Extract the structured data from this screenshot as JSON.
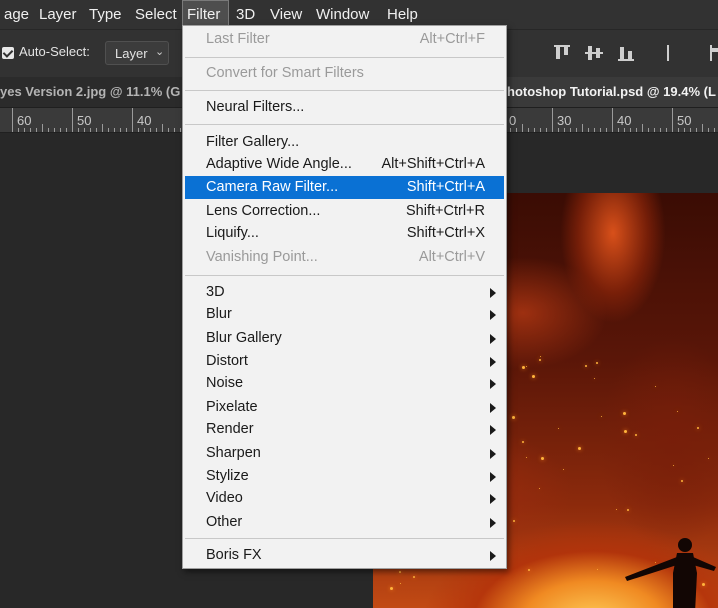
{
  "menubar": {
    "items": [
      {
        "id": "image",
        "label": "age"
      },
      {
        "id": "layer",
        "label": "Layer"
      },
      {
        "id": "type",
        "label": "Type"
      },
      {
        "id": "select",
        "label": "Select"
      },
      {
        "id": "filter",
        "label": "Filter"
      },
      {
        "id": "3d",
        "label": "3D"
      },
      {
        "id": "view",
        "label": "View"
      },
      {
        "id": "window",
        "label": "Window"
      },
      {
        "id": "help",
        "label": "Help"
      }
    ],
    "active": "filter"
  },
  "options_bar": {
    "auto_select_label": "Auto-Select:",
    "auto_select_checked": true,
    "layer_select_value": "Layer",
    "icons": [
      "align-top-icon",
      "align-vertical-center-icon",
      "align-bottom-icon",
      "align-left-icon",
      "align-horizontal-center-icon"
    ]
  },
  "tabs": [
    {
      "label": "yes Version 2.jpg @ 11.1% (G",
      "active": false
    },
    {
      "label": "hotoshop Tutorial.psd @ 19.4% (L",
      "active": true
    }
  ],
  "ruler": {
    "left_numbers": [
      "60",
      "50",
      "40"
    ],
    "right_numbers": [
      "0",
      "30",
      "40",
      "50"
    ]
  },
  "filter_menu": {
    "items": [
      {
        "label": "Last Filter",
        "shortcut": "Alt+Ctrl+F",
        "disabled": true
      },
      {
        "sep": true
      },
      {
        "label": "Convert for Smart Filters",
        "disabled": true
      },
      {
        "sep": true
      },
      {
        "label": "Neural Filters..."
      },
      {
        "sep": true
      },
      {
        "label": "Filter Gallery..."
      },
      {
        "label": "Adaptive Wide Angle...",
        "shortcut": "Alt+Shift+Ctrl+A"
      },
      {
        "label": "Camera Raw Filter...",
        "shortcut": "Shift+Ctrl+A",
        "highlighted": true
      },
      {
        "label": "Lens Correction...",
        "shortcut": "Shift+Ctrl+R"
      },
      {
        "label": "Liquify...",
        "shortcut": "Shift+Ctrl+X"
      },
      {
        "label": "Vanishing Point...",
        "shortcut": "Alt+Ctrl+V",
        "disabled": true
      },
      {
        "sep": true
      },
      {
        "label": "3D",
        "submenu": true
      },
      {
        "label": "Blur",
        "submenu": true
      },
      {
        "label": "Blur Gallery",
        "submenu": true
      },
      {
        "label": "Distort",
        "submenu": true
      },
      {
        "label": "Noise",
        "submenu": true
      },
      {
        "label": "Pixelate",
        "submenu": true
      },
      {
        "label": "Render",
        "submenu": true
      },
      {
        "label": "Sharpen",
        "submenu": true
      },
      {
        "label": "Stylize",
        "submenu": true
      },
      {
        "label": "Video",
        "submenu": true
      },
      {
        "label": "Other",
        "submenu": true
      },
      {
        "sep": true
      },
      {
        "label": "Boris FX",
        "submenu": true
      }
    ]
  },
  "colors": {
    "highlight": "#0a71d4",
    "menu_bg": "#f2f2f2",
    "chrome_bg": "#323232",
    "canvas_bg": "#282828"
  }
}
